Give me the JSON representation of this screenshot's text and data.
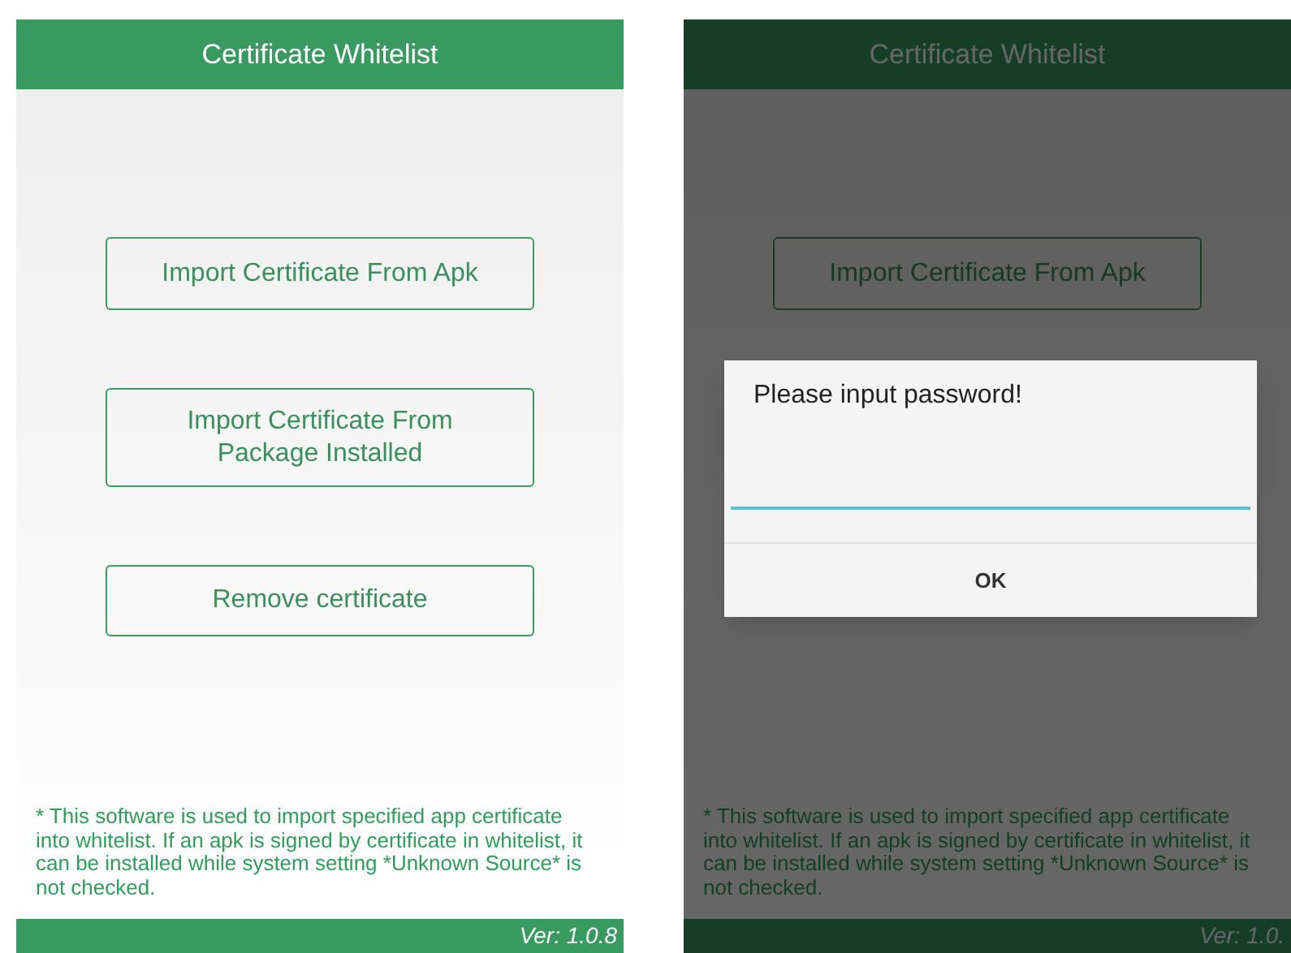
{
  "screens": [
    {
      "title": "Certificate Whitelist",
      "dimmed": false,
      "buttons": [
        {
          "label": "Import Certificate From Apk"
        },
        {
          "label": "Import Certificate From Package Installed"
        },
        {
          "label": "Remove certificate"
        }
      ],
      "note": "* This software is used to import specified app certificate into whitelist. If an apk is signed by certificate in whitelist, it can be installed while system setting *Unknown Source* is not checked.",
      "version": "Ver: 1.0.8"
    },
    {
      "title": "Certificate Whitelist",
      "dimmed": true,
      "buttons": [
        {
          "label": "Import Certificate From Apk"
        }
      ],
      "note": "* This software is used to import specified app certificate into whitelist. If an apk is signed by certificate in whitelist, it can be installed while system setting *Unknown Source* is not checked.",
      "version": "Ver: 1.0.",
      "dialog": {
        "title": "Please input password!",
        "ok": "OK"
      }
    }
  ]
}
